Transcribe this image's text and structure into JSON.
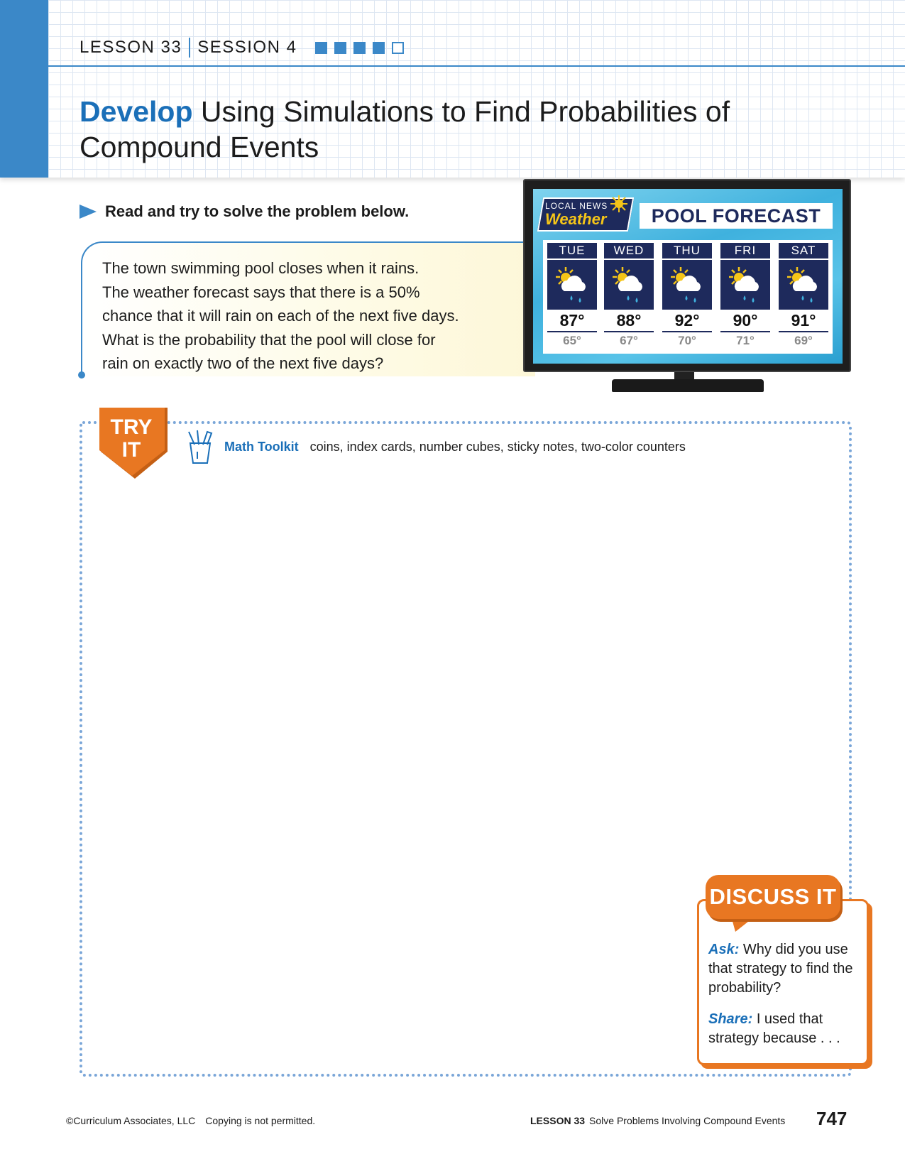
{
  "header": {
    "lesson": "LESSON 33",
    "session": "SESSION 4",
    "progress_filled": 4,
    "progress_total": 5,
    "title_strong": "Develop",
    "title_rest": "Using Simulations to Find Probabilities of Compound Events"
  },
  "instruction": "Read and try to solve the problem below.",
  "problem": {
    "lines": [
      "The town swimming pool closes when it rains.",
      "The weather forecast says that there is a 50%",
      "chance that it will rain on each of the next five days.",
      "What is the probability that the pool will close for",
      "rain on exactly two of the next five days?"
    ]
  },
  "tv": {
    "badge_top": "LOCAL NEWS",
    "badge_main": "Weather",
    "title": "POOL FORECAST",
    "days": [
      {
        "name": "TUE",
        "high": "87°",
        "low": "65°"
      },
      {
        "name": "WED",
        "high": "88°",
        "low": "67°"
      },
      {
        "name": "THU",
        "high": "92°",
        "low": "70°"
      },
      {
        "name": "FRI",
        "high": "90°",
        "low": "71°"
      },
      {
        "name": "SAT",
        "high": "91°",
        "low": "69°"
      }
    ],
    "icon": "sun-cloud-rain-icon"
  },
  "try_it": {
    "badge_line1": "TRY",
    "badge_line2": "IT",
    "toolkit_label": "Math Toolkit",
    "toolkit_items": "coins, index cards, number cubes, sticky notes, two-color counters"
  },
  "discuss": {
    "title": "DISCUSS IT",
    "ask_label": "Ask:",
    "ask_text": "Why did you use that strategy to find the probability?",
    "share_label": "Share:",
    "share_text": "I used that strategy because . . ."
  },
  "footer": {
    "copyright": "©Curriculum Associates, LLC",
    "notice": "Copying is not permitted.",
    "lesson": "LESSON 33",
    "lesson_title": "Solve Problems Involving Compound Events",
    "page": "747"
  },
  "colors": {
    "accent_blue": "#3b88c8",
    "title_blue": "#1a6fb8",
    "orange": "#e87722",
    "navy": "#1e2a5c"
  }
}
